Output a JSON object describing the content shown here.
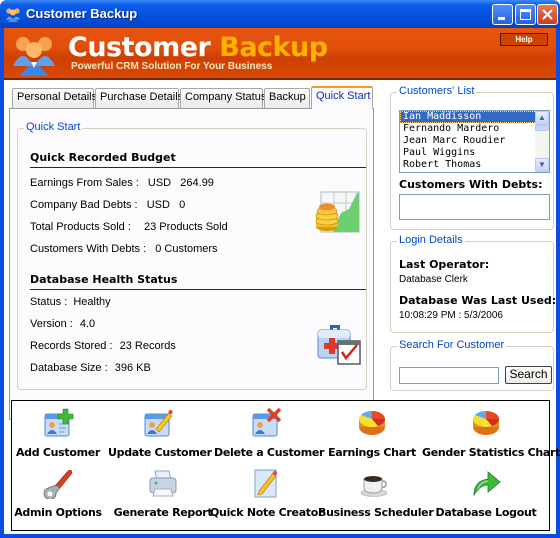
{
  "window": {
    "title": "Customer Backup",
    "controls": {
      "minimize": "minimize",
      "maximize": "maximize",
      "close": "close"
    }
  },
  "header": {
    "brand_part1": "Customer",
    "brand_part2": "Backup",
    "tagline": "Powerful CRM Solution For Your Business",
    "help_label": "Help"
  },
  "tabs": [
    {
      "label": "Personal Details",
      "active": false
    },
    {
      "label": "Purchase Details",
      "active": false
    },
    {
      "label": "Company Status",
      "active": false
    },
    {
      "label": "Backup",
      "active": false
    },
    {
      "label": "Quick Start",
      "active": true
    }
  ],
  "quick_start": {
    "group_label": "Quick Start",
    "budget": {
      "title": "Quick Recorded Budget",
      "rows": [
        {
          "label": "Earnings From Sales :",
          "value": "USD   264.99"
        },
        {
          "label": "Company Bad Debts :",
          "value": "USD   0"
        },
        {
          "label": "Total Products Sold :",
          "value": "23 Products Sold"
        },
        {
          "label": "Customers With Debts :",
          "value": "0 Customers"
        }
      ],
      "icon": "earnings-coins-chart-icon"
    },
    "health": {
      "title": "Database Health Status",
      "rows": [
        {
          "label": "Status :",
          "value": "Healthy"
        },
        {
          "label": "Version :",
          "value": "4.0"
        },
        {
          "label": "Records Stored :",
          "value": "23 Records"
        },
        {
          "label": "Database Size :",
          "value": "396 KB"
        }
      ],
      "icon": "medical-kit-checklist-icon"
    }
  },
  "customers_list": {
    "group_label": "Customers' List",
    "items": [
      "Ian Maddisson",
      "Fernando Mardero",
      "Jean Marc Roudier",
      "Paul Wiggins",
      "Robert Thomas"
    ],
    "selected_index": 0,
    "debts_label": "Customers With Debts:",
    "debts_items": []
  },
  "login_details": {
    "group_label": "Login Details",
    "last_operator_label": "Last Operator:",
    "last_operator_value": "Database Clerk",
    "last_used_label": "Database Was Last Used:",
    "last_used_value": "10:08:29 PM : 5/3/2006"
  },
  "search": {
    "group_label": "Search For Customer",
    "input_value": "",
    "input_placeholder": "",
    "button_label": "Search"
  },
  "actions": [
    {
      "label": "Add Customer",
      "icon": "add-customer-icon"
    },
    {
      "label": "Update Customer",
      "icon": "update-customer-icon"
    },
    {
      "label": "Delete a Customer",
      "icon": "delete-customer-icon"
    },
    {
      "label": "Earnings Chart",
      "icon": "pie-chart-icon"
    },
    {
      "label": "Gender Statistics Chart",
      "icon": "pie-chart-icon"
    },
    {
      "label": "Admin Options",
      "icon": "wrench-icon"
    },
    {
      "label": "Generate Report",
      "icon": "printer-icon"
    },
    {
      "label": "Quick Note Creator",
      "icon": "note-pencil-icon"
    },
    {
      "label": "Business Scheduler",
      "icon": "coffee-cup-icon"
    },
    {
      "label": "Database Logout",
      "icon": "logout-arrow-icon"
    }
  ],
  "colors": {
    "titlebar": "#0455e0",
    "header": "#e04e0a",
    "brand_accent": "#ffb200",
    "legend_blue": "#0046d5",
    "selection": "#316ac5"
  }
}
